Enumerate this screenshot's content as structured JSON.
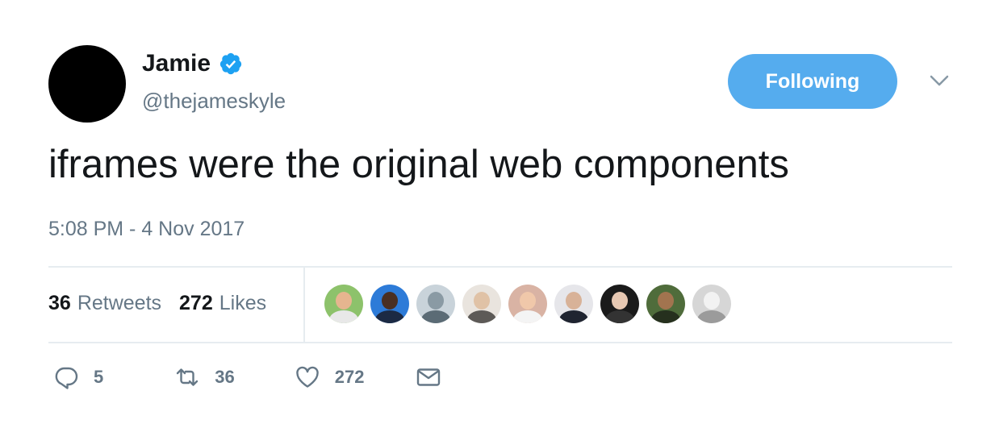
{
  "author": {
    "name": "Jamie",
    "handle": "@thejameskyle",
    "verified_color": "#1da1f2"
  },
  "follow_button": {
    "label": "Following",
    "color": "#55acee"
  },
  "tweet": {
    "text": "iframes were the original web components",
    "timestamp": "5:08 PM - 4 Nov 2017"
  },
  "stats": {
    "retweets_count": "36",
    "retweets_label": "Retweets",
    "likes_count": "272",
    "likes_label": "Likes"
  },
  "likers": [
    {
      "bg": "#8dc26b",
      "skin": "#e6b58f",
      "shirt": "#e8e8e8"
    },
    {
      "bg": "#2d7bd8",
      "skin": "#4a2f22",
      "shirt": "#1c2a44"
    },
    {
      "bg": "#c9d3da",
      "skin": "#8a9aa4",
      "shirt": "#5b6b75"
    },
    {
      "bg": "#e9e4de",
      "skin": "#e0c2a6",
      "shirt": "#5d5a57"
    },
    {
      "bg": "#d9b3a4",
      "skin": "#f0c8aa",
      "shirt": "#f4f4f4"
    },
    {
      "bg": "#e6e6ea",
      "skin": "#d8b298",
      "shirt": "#1f2430"
    },
    {
      "bg": "#1a1a1a",
      "skin": "#e7c8b2",
      "shirt": "#333333"
    },
    {
      "bg": "#4f6c3b",
      "skin": "#a2744f",
      "shirt": "#26301e"
    },
    {
      "bg": "#d6d6d6",
      "skin": "#f2f2f2",
      "shirt": "#9b9b9b"
    }
  ],
  "actions": {
    "reply_count": "5",
    "retweet_count": "36",
    "like_count": "272"
  },
  "icons": {
    "verified": "verified-badge-icon",
    "caret": "chevron-down-icon",
    "reply": "reply-icon",
    "retweet": "retweet-icon",
    "like": "heart-icon",
    "dm": "envelope-icon"
  }
}
